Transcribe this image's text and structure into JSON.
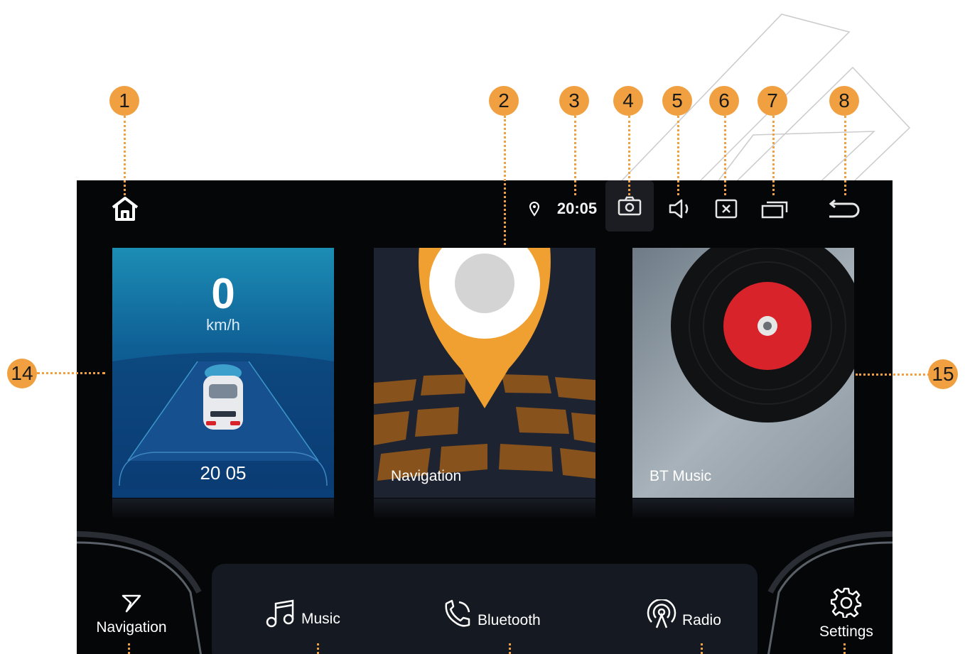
{
  "markers": [
    "1",
    "2",
    "3",
    "4",
    "5",
    "6",
    "7",
    "8",
    "14",
    "15"
  ],
  "status_bar": {
    "clock": "20:05",
    "icons": [
      "home-icon",
      "location-pin-icon",
      "camera-icon",
      "volume-icon",
      "close-app-icon",
      "recent-apps-icon",
      "back-icon"
    ]
  },
  "cards": {
    "speed": {
      "value": "0",
      "unit": "km/h",
      "time": "20 05"
    },
    "navigation": {
      "label": "Navigation"
    },
    "bt_music": {
      "label": "BT Music"
    }
  },
  "dock": {
    "navigation": "Navigation",
    "music": "Music",
    "bluetooth": "Bluetooth",
    "radio": "Radio",
    "settings": "Settings"
  },
  "colors": {
    "accent": "#f0a040",
    "screen_bg": "#050608",
    "speed_card": "#1c8db5",
    "record_red": "#d8232a",
    "pin_orange": "#f0a030"
  }
}
